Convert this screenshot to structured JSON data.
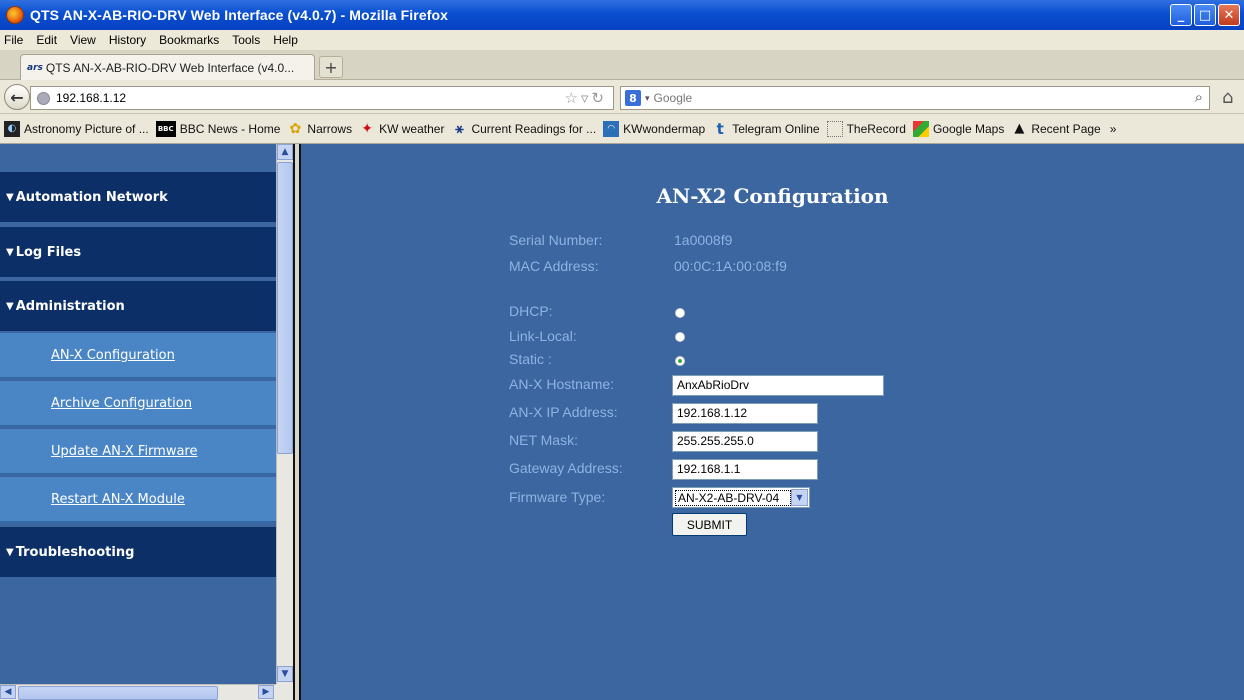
{
  "window": {
    "title": "QTS AN-X-AB-RIO-DRV Web Interface (v4.0.7) - Mozilla Firefox"
  },
  "menu": [
    "File",
    "Edit",
    "View",
    "History",
    "Bookmarks",
    "Tools",
    "Help"
  ],
  "tab": {
    "label": "QTS AN-X-AB-RIO-DRV Web Interface (v4.0...",
    "favicon_text": "ars",
    "new_tab": "+"
  },
  "nav": {
    "url": "192.168.1.12",
    "search_engine": "8",
    "search_placeholder": "Google"
  },
  "bookmarks": [
    {
      "label": "Astronomy Picture of ...",
      "icon": "nebula-icon"
    },
    {
      "label": "BBC News - Home",
      "icon": "bbc-icon"
    },
    {
      "label": "Narrows",
      "icon": "narrows-icon"
    },
    {
      "label": "KW weather",
      "icon": "maple-leaf-icon"
    },
    {
      "label": "Current Readings for ...",
      "icon": "weather-station-icon"
    },
    {
      "label": "KWwondermap",
      "icon": "map-icon"
    },
    {
      "label": "Telegram Online",
      "icon": "telegram-icon"
    },
    {
      "label": "TheRecord",
      "icon": "page-icon"
    },
    {
      "label": "Google Maps",
      "icon": "google-maps-icon"
    },
    {
      "label": "Recent Page",
      "icon": "recent-page-icon"
    }
  ],
  "sidebar": {
    "automation": "Automation Network",
    "logs": "Log Files",
    "admin": "Administration",
    "items": [
      "AN-X Configuration",
      "Archive Configuration",
      "Update AN-X Firmware",
      "Restart AN-X Module"
    ],
    "troubleshooting": "Troubleshooting"
  },
  "form": {
    "title": "AN-X2 Configuration",
    "serial_label": "Serial Number:",
    "serial_value": "1a0008f9",
    "mac_label": "MAC Address:",
    "mac_value": "00:0C:1A:00:08:f9",
    "dhcp_label": "DHCP:",
    "linklocal_label": "Link-Local:",
    "static_label": "Static :",
    "selected_mode": "Static",
    "hostname_label": "AN-X Hostname:",
    "hostname_value": "AnxAbRioDrv",
    "ip_label": "AN-X IP Address:",
    "ip_value": "192.168.1.12",
    "netmask_label": "NET Mask:",
    "netmask_value": "255.255.255.0",
    "gateway_label": "Gateway Address:",
    "gateway_value": "192.168.1.1",
    "firmware_label": "Firmware Type:",
    "firmware_value": "AN-X2-AB-DRV-04",
    "submit_label": "SUBMIT"
  },
  "colors": {
    "sidebar_section": "#0d2f67",
    "sidebar_item": "#4a86c6",
    "page_bg": "#3b66a0",
    "label": "#8fb3e2"
  }
}
